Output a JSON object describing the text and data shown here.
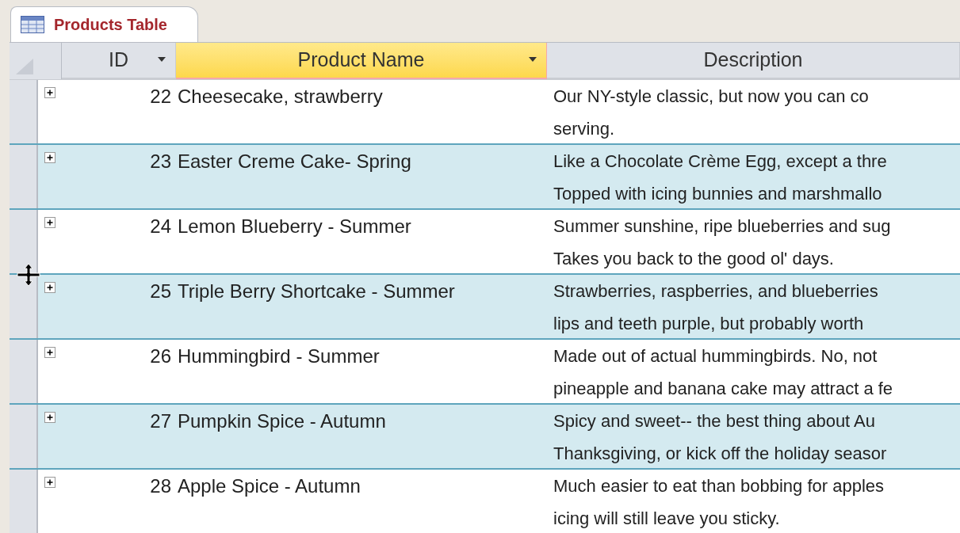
{
  "tab": {
    "title": "Products Table",
    "selected": true
  },
  "columns": [
    {
      "label": "ID",
      "selected": false,
      "filter_button": true
    },
    {
      "label": "Product Name",
      "selected": true,
      "filter_button": true
    },
    {
      "label": "Description",
      "selected": false,
      "filter_button": false
    }
  ],
  "rows": [
    {
      "id": "22",
      "name": "Cheesecake, strawberry",
      "description": [
        "Our NY-style classic, but now you can co",
        "serving."
      ]
    },
    {
      "id": "23",
      "name": "Easter Creme Cake- Spring",
      "description": [
        "Like a Chocolate Crème Egg, except a thre",
        "Topped with icing bunnies and marshmallo"
      ]
    },
    {
      "id": "24",
      "name": "Lemon Blueberry - Summer",
      "description": [
        "Summer sunshine, ripe blueberries and sug",
        "Takes you back to the good ol' days."
      ]
    },
    {
      "id": "25",
      "name": "Triple Berry Shortcake - Summer",
      "description": [
        "Strawberries, raspberries, and blueberries",
        "lips and teeth purple, but probably worth"
      ]
    },
    {
      "id": "26",
      "name": "Hummingbird - Summer",
      "description": [
        "Made out of actual hummingbirds. No, not",
        "pineapple and banana cake may attract a fe"
      ]
    },
    {
      "id": "27",
      "name": "Pumpkin Spice - Autumn",
      "description": [
        "Spicy and sweet-- the best thing about Au",
        "Thanksgiving, or kick off the holiday seasor"
      ]
    },
    {
      "id": "28",
      "name": "Apple Spice - Autumn",
      "description": [
        "Much easier to eat than bobbing for apples",
        "icing will still leave you sticky."
      ]
    }
  ]
}
